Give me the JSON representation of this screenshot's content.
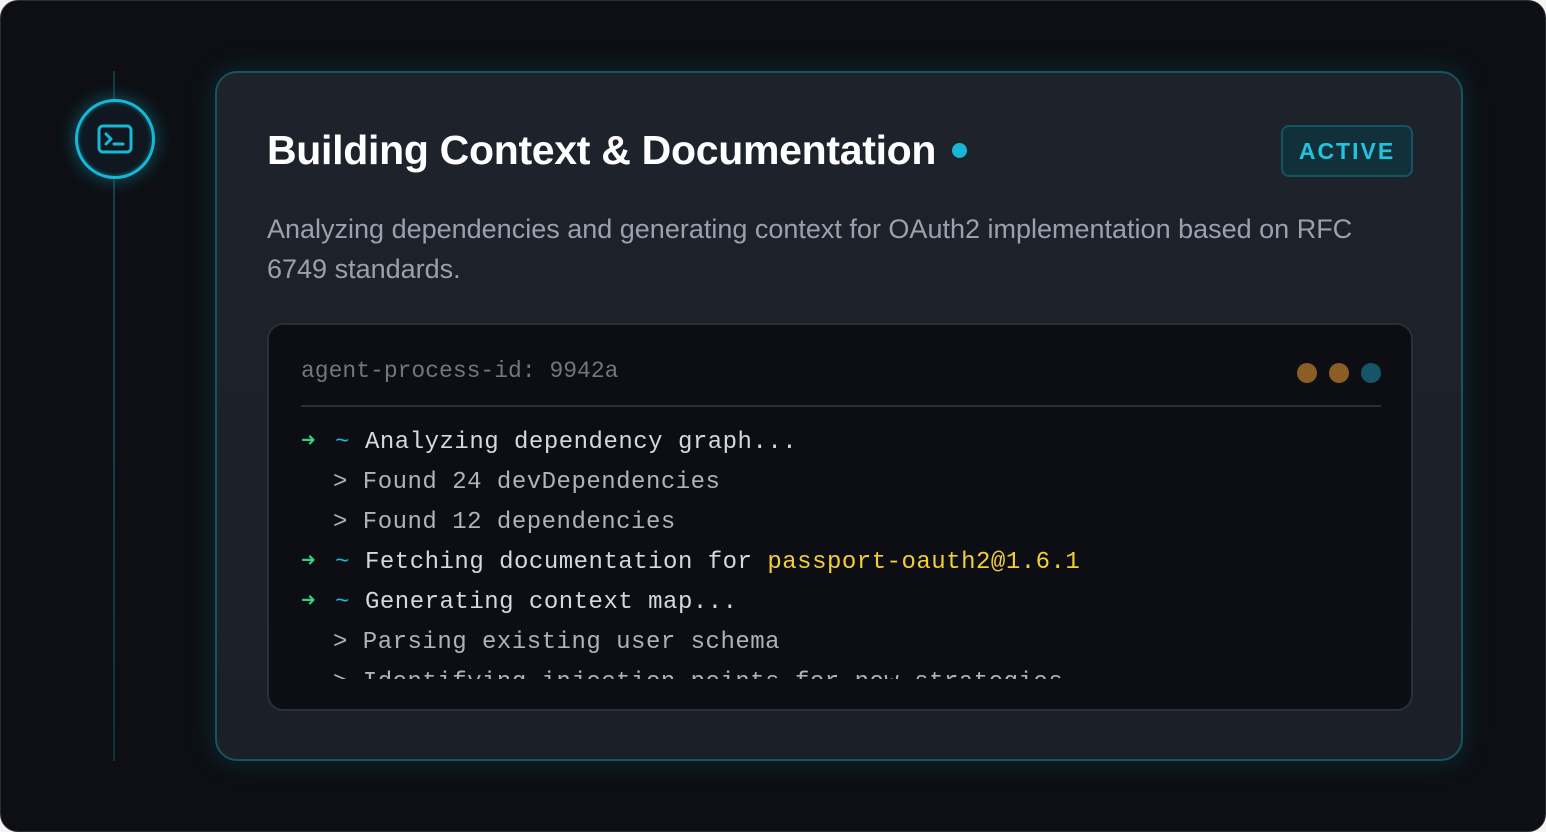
{
  "step": {
    "icon": "terminal-icon",
    "title": "Building Context & Documentation",
    "status_badge": "ACTIVE",
    "description": "Analyzing dependencies and generating context for OAuth2 implementation based on RFC 6749 standards."
  },
  "terminal": {
    "process_label": "agent-process-id: 9942a",
    "window_dots": [
      "#8a5e24",
      "#8a5e24",
      "#145567"
    ],
    "lines": [
      {
        "type": "step",
        "prefix_arrow": "➜",
        "prefix_tilde": "~",
        "text": "Analyzing dependency graph..."
      },
      {
        "type": "sub",
        "text": "> Found 24 devDependencies"
      },
      {
        "type": "sub",
        "text": "> Found 12 dependencies"
      },
      {
        "type": "step",
        "prefix_arrow": "➜",
        "prefix_tilde": "~",
        "text": "Fetching documentation for ",
        "highlight": "passport-oauth2@1.6.1"
      },
      {
        "type": "step",
        "prefix_arrow": "➜",
        "prefix_tilde": "~",
        "text": "Generating context map..."
      },
      {
        "type": "sub",
        "text": "> Parsing existing user schema"
      },
      {
        "type": "sub",
        "text": "> Identifying injection points for new strategies"
      }
    ]
  },
  "colors": {
    "accent": "#16b6d4",
    "success_arrow": "#35d07f",
    "highlight": "#f2cf35",
    "background": "#0d0f14"
  }
}
